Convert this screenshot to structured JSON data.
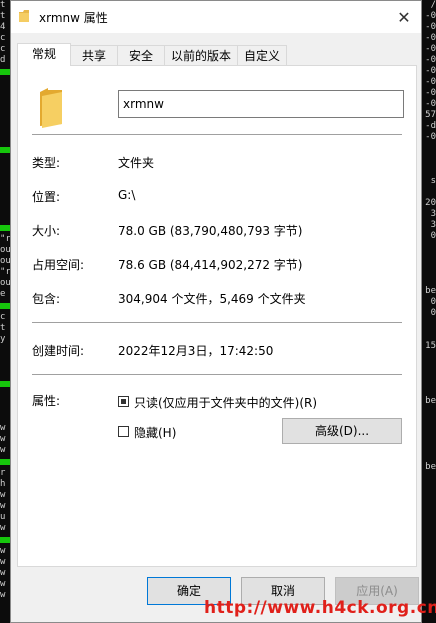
{
  "window": {
    "title": "xrmnw 属性",
    "close_icon": "close-icon"
  },
  "tabs": [
    {
      "label": "常规",
      "active": true
    },
    {
      "label": "共享",
      "active": false
    },
    {
      "label": "安全",
      "active": false
    },
    {
      "label": "以前的版本",
      "active": false
    },
    {
      "label": "自定义",
      "active": false
    }
  ],
  "general": {
    "name": "xrmnw",
    "rows": [
      {
        "label": "类型:",
        "value": "文件夹"
      },
      {
        "label": "位置:",
        "value": "G:\\"
      },
      {
        "label": "大小:",
        "value": "78.0 GB (83,790,480,793 字节)"
      },
      {
        "label": "占用空间:",
        "value": "78.6 GB (84,414,902,272 字节)"
      },
      {
        "label": "包含:",
        "value": "304,904 个文件，5,469 个文件夹"
      }
    ],
    "created_label": "创建时间:",
    "created_value": "2022年12月3日，17:42:50",
    "attributes_label": "属性:",
    "readonly_label": "只读(仅应用于文件夹中的文件)(R)",
    "readonly_checked": "indeterminate",
    "hidden_label": "隐藏(H)",
    "hidden_checked": false,
    "advanced_label": "高级(D)..."
  },
  "buttons": {
    "ok": "确定",
    "cancel": "取消",
    "apply": "应用(A)"
  },
  "watermark": "http://www.h4ck.org.cn",
  "background": {
    "left_terminal": [
      "t",
      "t",
      "4",
      "c",
      "c",
      "d",
      "",
      "",
      "",
      "",
      "",
      "",
      "",
      "",
      "",
      "",
      "",
      "",
      "\"r",
      "ou",
      "ou",
      "\"r",
      "ou",
      "e",
      "c",
      "t",
      "y",
      "",
      "",
      "",
      "",
      "",
      "",
      "w",
      "w",
      "w",
      "r",
      "h",
      "w",
      "w",
      "u",
      "w",
      "w",
      "w",
      "w",
      "w",
      "w"
    ],
    "right_terminal": [
      "/",
      "-0",
      "-0",
      "-0",
      "-0",
      "-0",
      "-0",
      "-0",
      "-0",
      "-0",
      "57",
      "-d",
      "-0",
      "",
      "",
      "",
      "s",
      "",
      "20",
      "3",
      "3",
      "0",
      "",
      "",
      "",
      "",
      "be",
      "0",
      "0",
      "",
      "",
      "15",
      "",
      "",
      "",
      "",
      "be",
      "",
      "",
      "",
      "",
      "",
      "be",
      "",
      "",
      "",
      "",
      "",
      "",
      "",
      "",
      "",
      "",
      "",
      "",
      "",
      "",
      ""
    ]
  }
}
